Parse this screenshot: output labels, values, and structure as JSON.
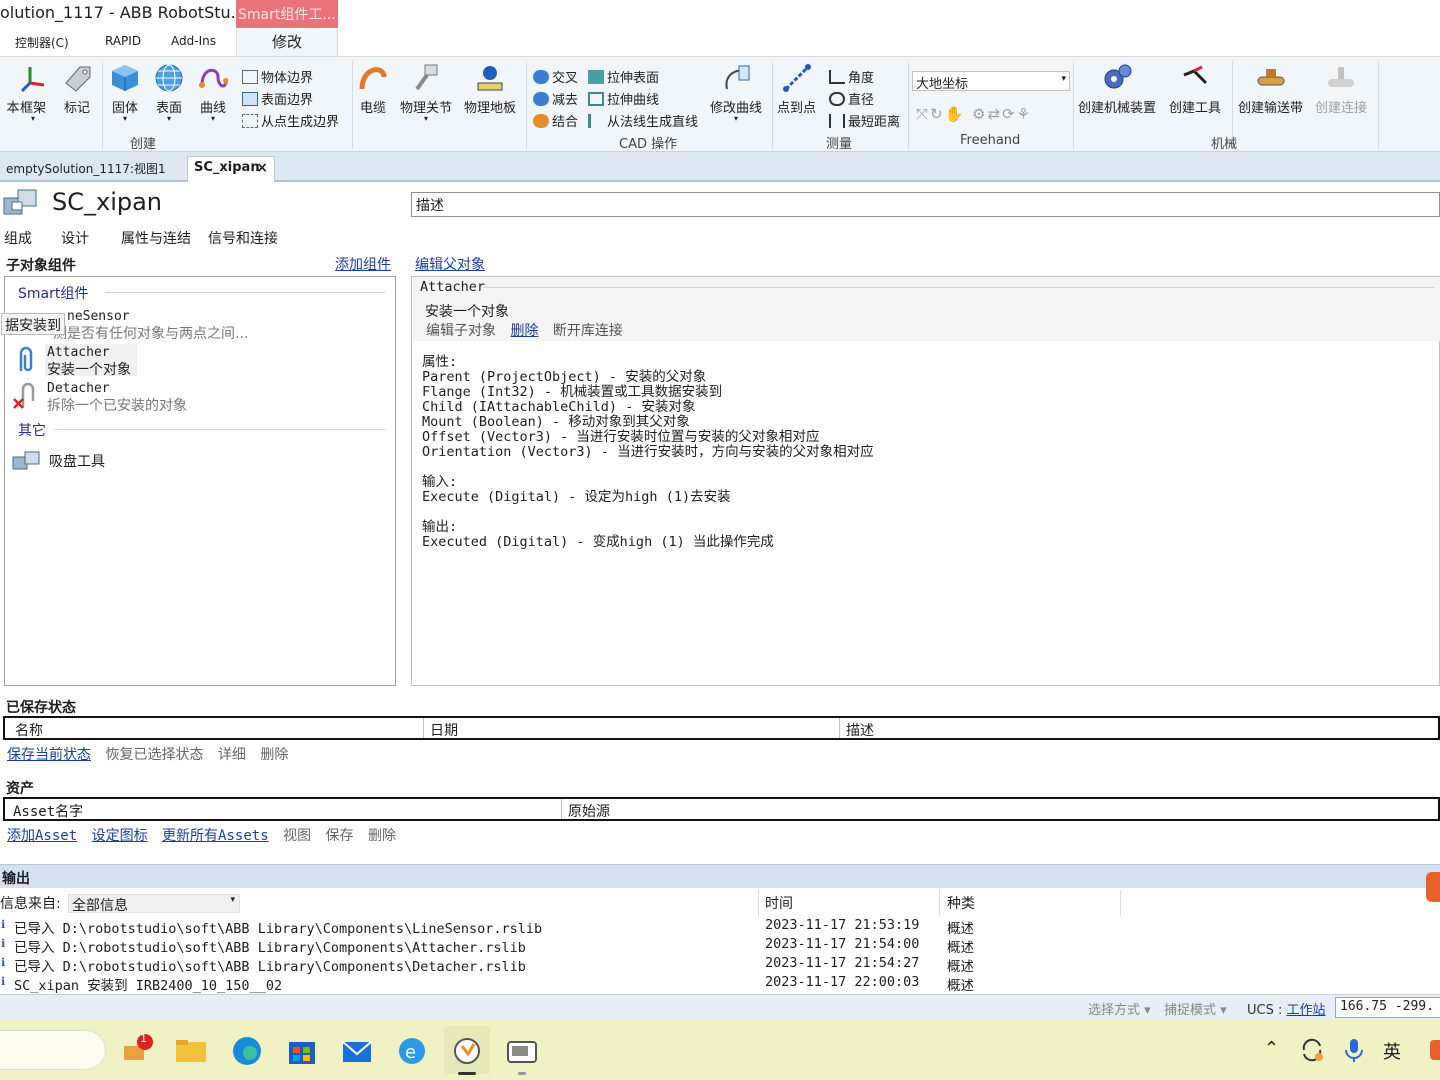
{
  "window": {
    "title": "olution_1117 - ABB RobotStu...",
    "context_tab_header": "Smart组件工..."
  },
  "ribbon_tabs": {
    "controller": "控制器(C)",
    "rapid": "RAPID",
    "addins": "Add-Ins",
    "modify": "修改"
  },
  "ribbon": {
    "create": {
      "label": "创建",
      "edge_cut": "本",
      "frame": "框架",
      "marker": "标记",
      "solid": "固体",
      "surface": "表面",
      "curve": "曲线",
      "body_edge": "物体边界",
      "surface_edge": "表面边界",
      "edge_from_points": "从点生成边界"
    },
    "physics": {
      "cable": "电缆",
      "joint": "物理关节",
      "floor": "物理地板"
    },
    "cad": {
      "label": "CAD 操作",
      "intersect": "交叉",
      "subtract": "减去",
      "union": "结合",
      "extrude_surface": "拉伸表面",
      "extrude_curve": "拉伸曲线",
      "line_from_normal": "从法线生成直线",
      "modify_curve": "修改曲线"
    },
    "measure": {
      "label": "测量",
      "point_to_point": "点到点",
      "angle": "角度",
      "diameter": "直径",
      "min_distance": "最短距离"
    },
    "freehand": {
      "label": "Freehand",
      "coord_value": "大地坐标"
    },
    "mechanism": {
      "label": "机械",
      "create_mechanism": "创建机械装置",
      "create_tool": "创建工具",
      "create_conveyor": "创建输送带",
      "create_connection": "创建连接"
    }
  },
  "doc_tabs": {
    "tab1": "emptySolution_1117:视图1",
    "tab2": "SC_xipan",
    "close": "×"
  },
  "editor": {
    "title": "SC_xipan",
    "description": "描述",
    "tabs": [
      "组成",
      "设计",
      "属性与连结",
      "信号和连接"
    ]
  },
  "left": {
    "header": "子对象组件",
    "add_component": "添加组件",
    "cat_smart": "Smart组件",
    "cat_other": "其它",
    "tooltip": "据安装到",
    "components": [
      {
        "name": "LineSensor",
        "name_visible": "neSensor",
        "desc": "测是否有任何对象与两点之间..."
      },
      {
        "name": "Attacher",
        "desc": "安装一个对象"
      },
      {
        "name": "Detacher",
        "desc": "拆除一个已安装的对象"
      }
    ],
    "other_item": "吸盘工具"
  },
  "right": {
    "edit_parent": "编辑父对象",
    "group_title": "Attacher",
    "summary": "安装一个对象",
    "edit_child": "编辑子对象",
    "delete": "删除",
    "break_link": "断开库连接",
    "doc_lines": [
      "属性:",
      "Parent (ProjectObject) - 安装的父对象",
      "Flange (Int32) - 机械装置或工具数据安装到",
      "Child (IAttachableChild) - 安装对象",
      "Mount (Boolean) - 移动对象到其父对象",
      "Offset (Vector3) - 当进行安装时位置与安装的父对象相对应",
      "Orientation (Vector3) - 当进行安装时，方向与安装的父对象相对应",
      "",
      "输入:",
      "Execute (Digital) - 设定为high (1)去安装",
      "",
      "输出:",
      "Executed (Digital) - 变成high (1) 当此操作完成"
    ]
  },
  "saved_states": {
    "header": "已保存状态",
    "columns": [
      "名称",
      "日期",
      "描述"
    ],
    "save_current": "保存当前状态",
    "restore": "恢复已选择状态",
    "details": "详细",
    "delete": "删除"
  },
  "assets": {
    "header": "资产",
    "columns": [
      "Asset名字",
      "原始源"
    ],
    "add_asset": "添加Asset",
    "set_icon": "设定图标",
    "update_all": "更新所有Assets",
    "view": "视图",
    "save": "保存",
    "delete": "删除"
  },
  "output": {
    "header": "输出",
    "filter_label": "信息来自:",
    "filter_value": "全部信息",
    "col_time": "时间",
    "col_type": "种类",
    "rows": [
      {
        "msg": "已导入 D:\\robotstudio\\soft\\ABB Library\\Components\\LineSensor.rslib",
        "time": "2023-11-17 21:53:19",
        "type": "概述"
      },
      {
        "msg": "已导入 D:\\robotstudio\\soft\\ABB Library\\Components\\Attacher.rslib",
        "time": "2023-11-17 21:54:00",
        "type": "概述"
      },
      {
        "msg": "已导入 D:\\robotstudio\\soft\\ABB Library\\Components\\Detacher.rslib",
        "time": "2023-11-17 21:54:27",
        "type": "概述"
      },
      {
        "msg": "SC_xipan 安装到 IRB2400_10_150__02",
        "time": "2023-11-17 22:00:03",
        "type": "概述"
      }
    ]
  },
  "statusbar": {
    "select_mode": "选择方式",
    "snap_mode": "捕捉模式",
    "ucs_label": "UCS :",
    "ucs_value": "工作站",
    "coord": "166.75   -299."
  },
  "taskbar": {
    "badge": "1",
    "ime": "英"
  },
  "colors": {
    "context_tab": "#e8737b",
    "ribbon_bg": "#f1f6fb",
    "link": "#1a3ea8",
    "output_header": "#d3e1f0",
    "taskbar": "#f0f2c4"
  }
}
